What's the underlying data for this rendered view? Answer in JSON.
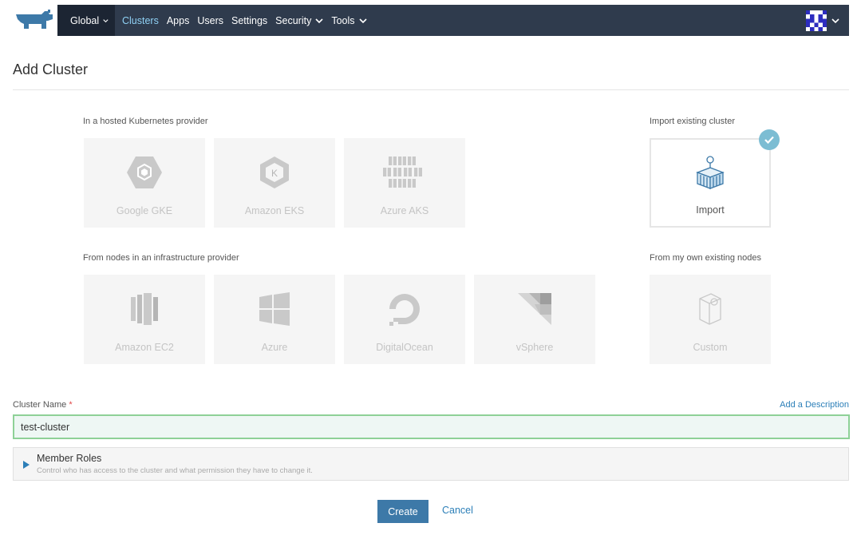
{
  "nav": {
    "global_label": "Global",
    "items": [
      {
        "label": "Clusters",
        "active": true
      },
      {
        "label": "Apps",
        "active": false
      },
      {
        "label": "Users",
        "active": false
      },
      {
        "label": "Settings",
        "active": false
      },
      {
        "label": "Security",
        "active": false,
        "dropdown": true
      },
      {
        "label": "Tools",
        "active": false,
        "dropdown": true
      }
    ],
    "colors": {
      "bar": "#2f3b4d",
      "active": "#8fd1f5"
    }
  },
  "page": {
    "title": "Add Cluster"
  },
  "sections": {
    "hosted_label": "In a hosted Kubernetes provider",
    "import_label": "Import existing cluster",
    "infra_label": "From nodes in an infrastructure provider",
    "custom_label": "From my own existing nodes"
  },
  "providers": {
    "hosted": [
      {
        "label": "Google GKE",
        "icon": "gke-hexagon-icon"
      },
      {
        "label": "Amazon EKS",
        "icon": "eks-hexagon-icon"
      },
      {
        "label": "Azure AKS",
        "icon": "aks-cubes-icon"
      }
    ],
    "import": {
      "label": "Import",
      "icon": "import-container-icon",
      "selected": true
    },
    "infra": [
      {
        "label": "Amazon EC2",
        "icon": "ec2-icon"
      },
      {
        "label": "Azure",
        "icon": "windows-icon"
      },
      {
        "label": "DigitalOcean",
        "icon": "digitalocean-icon"
      },
      {
        "label": "vSphere",
        "icon": "vsphere-icon"
      }
    ],
    "custom": {
      "label": "Custom",
      "icon": "custom-node-icon"
    }
  },
  "form": {
    "cluster_name_label": "Cluster Name",
    "required_mark": "*",
    "add_description": "Add a Description",
    "cluster_name_value": "test-cluster",
    "member_roles_title": "Member Roles",
    "member_roles_subtitle": "Control who has access to the cluster and what permission they have to change it.",
    "create_label": "Create",
    "cancel_label": "Cancel"
  }
}
